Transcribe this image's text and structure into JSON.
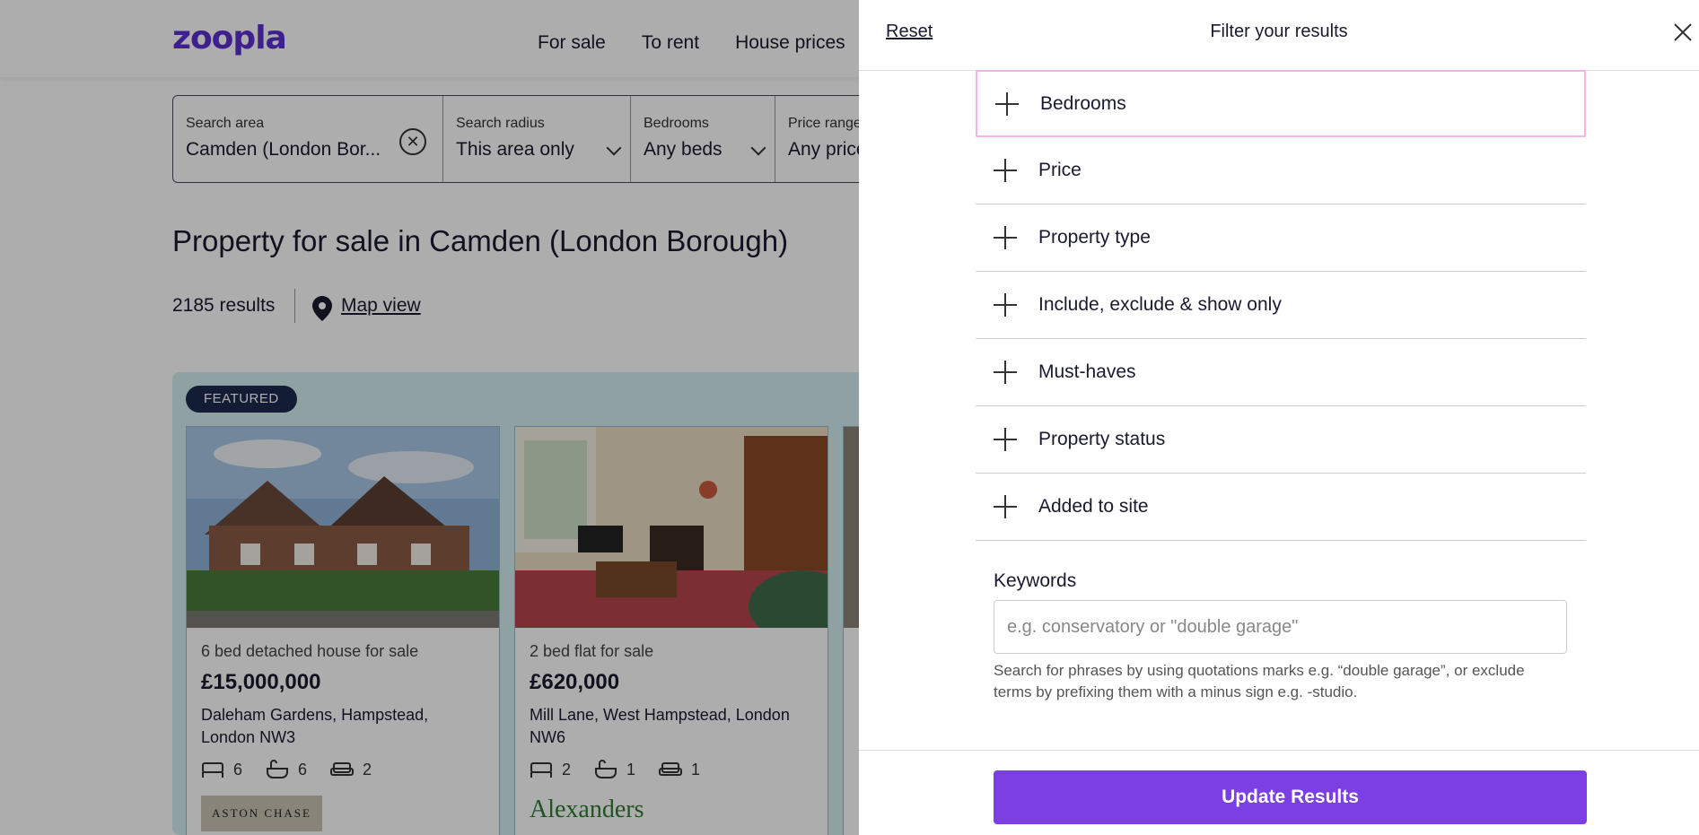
{
  "header": {
    "logo": "zoopla",
    "nav": [
      "For sale",
      "To rent",
      "House prices"
    ]
  },
  "search": {
    "area_label": "Search area",
    "area_value": "Camden (London Bor...",
    "radius_label": "Search radius",
    "radius_value": "This area only",
    "beds_label": "Bedrooms",
    "beds_value": "Any beds",
    "price_label": "Price range",
    "price_value": "Any price"
  },
  "results": {
    "title": "Property for sale in Camden (London Borough)",
    "count": "2185 results",
    "map_link": "Map view"
  },
  "featured": {
    "badge": "FEATURED",
    "cards": [
      {
        "subtitle": "6 bed detached house for sale",
        "price": "£15,000,000",
        "address": "Daleham Gardens, Hampstead, London NW3",
        "beds": "6",
        "baths": "6",
        "receptions": "2",
        "agent": "ASTON CHASE"
      },
      {
        "subtitle": "2 bed flat for sale",
        "price": "£620,000",
        "address": "Mill Lane, West Hampstead, London NW6",
        "beds": "2",
        "baths": "1",
        "receptions": "1",
        "agent": "Alexanders"
      }
    ]
  },
  "drawer": {
    "reset": "Reset",
    "title": "Filter your results",
    "filters": [
      "Bedrooms",
      "Price",
      "Property type",
      "Include, exclude & show only",
      "Must-haves",
      "Property status",
      "Added to site"
    ],
    "keywords_label": "Keywords",
    "keywords_placeholder": "e.g. conservatory or \"double garage\"",
    "keywords_help": "Search for phrases by using quotations marks e.g. “double garage”, or exclude terms by prefixing them with a minus sign e.g. -studio.",
    "update_button": "Update Results"
  },
  "colors": {
    "brand": "#5a2fd1",
    "button": "#7b3fe4",
    "badge": "#1b2a4e",
    "featured_bg": "#d3eeef"
  }
}
